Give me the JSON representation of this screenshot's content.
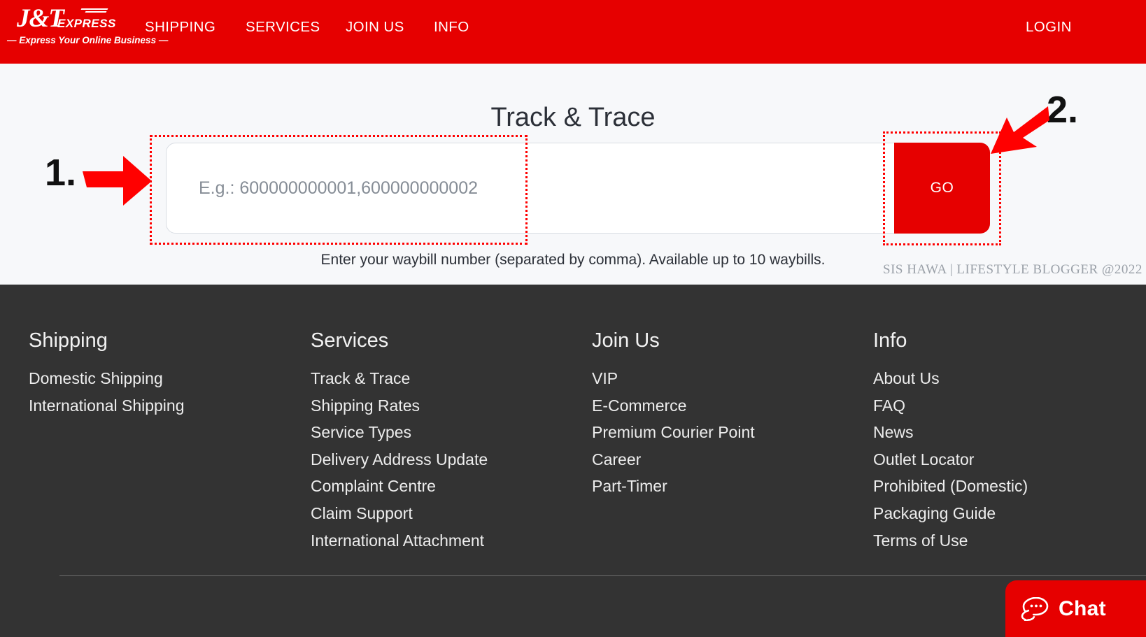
{
  "brand": {
    "logo_mark": "J&T",
    "logo_sub": "EXPRESS",
    "tagline": "— Express Your Online Business —",
    "accent_color": "#e60000"
  },
  "header": {
    "nav": [
      {
        "label": "SHIPPING"
      },
      {
        "label": "SERVICES"
      },
      {
        "label": "JOIN US"
      },
      {
        "label": "INFO"
      }
    ],
    "login_label": "LOGIN"
  },
  "hero": {
    "title": "Track & Trace",
    "input": {
      "value": "",
      "placeholder": "E.g.: 600000000001,600000000002"
    },
    "go_label": "GO",
    "hint": "Enter your waybill number (separated by comma). Available up to 10 waybills.",
    "watermark": "SIS HAWA  |  LIFESTYLE BLOGGER @2022"
  },
  "annotations": [
    {
      "number": "1.",
      "target": "waybill-input"
    },
    {
      "number": "2.",
      "target": "go-button"
    }
  ],
  "footer": {
    "columns": [
      {
        "heading": "Shipping",
        "links": [
          "Domestic Shipping",
          "International Shipping"
        ]
      },
      {
        "heading": "Services",
        "links": [
          "Track & Trace",
          "Shipping Rates",
          "Service Types",
          "Delivery Address Update",
          "Complaint Centre",
          "Claim Support",
          "International Attachment"
        ]
      },
      {
        "heading": "Join Us",
        "links": [
          "VIP",
          "E-Commerce",
          "Premium Courier Point",
          "Career",
          "Part-Timer"
        ]
      },
      {
        "heading": "Info",
        "links": [
          "About Us",
          "FAQ",
          "News",
          "Outlet Locator",
          "Prohibited (Domestic)",
          "Packaging Guide",
          "Terms of Use"
        ]
      }
    ]
  },
  "chat": {
    "label": "Chat",
    "icon": "chat-bubble-icon"
  }
}
